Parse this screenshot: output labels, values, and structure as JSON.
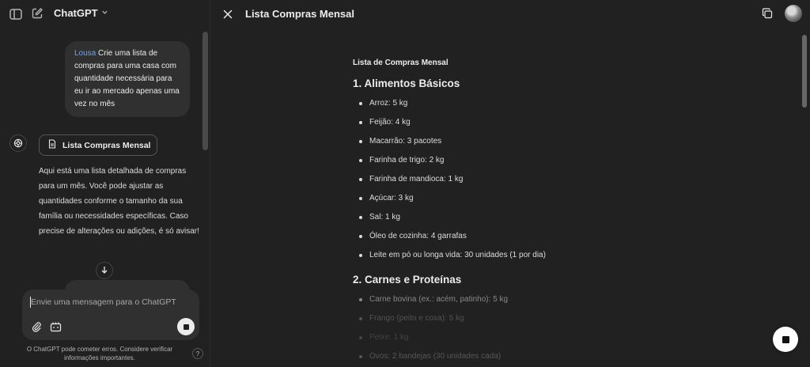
{
  "header": {
    "model_name": "ChatGPT"
  },
  "chat": {
    "user_message": {
      "tag": "Lousa",
      "text": "Crie uma lista de compras para uma casa com quantidade necessária para eu ir ao mercado apenas uma vez no mês"
    },
    "canvas_chip_label": "Lista Compras Mensal",
    "assistant_message": "Aqui está uma lista detalhada de compras para um mês. Você pode ajustar as quantidades conforme o tamanho da sua família ou necessidades específicas. Caso precise de alterações ou adições, é só avisar!"
  },
  "composer": {
    "placeholder": "Envie uma mensagem para o ChatGPT",
    "disclaimer": "O ChatGPT pode cometer erros. Considere verificar informações importantes.",
    "help_label": "?"
  },
  "canvas": {
    "title": "Lista Compras Mensal",
    "document_heading": "Lista de Compras Mensal",
    "sections": [
      {
        "title": "1. Alimentos Básicos",
        "items": [
          "Arroz: 5 kg",
          "Feijão: 4 kg",
          "Macarrão: 3 pacotes",
          "Farinha de trigo: 2 kg",
          "Farinha de mandioca: 1 kg",
          "Açúcar: 3 kg",
          "Sal: 1 kg",
          "Óleo de cozinha: 4 garrafas",
          "Leite em pó ou longa vida: 30 unidades (1 por dia)"
        ]
      },
      {
        "title": "2. Carnes e Proteínas",
        "items": [
          "Carne bovina (ex.: acém, patinho): 5 kg",
          "Frango (peito e coxa): 5 kg",
          "Peixe: 1 kg",
          "Ovos: 2 bandejas (30 unidades cada)"
        ]
      }
    ]
  },
  "icons": {
    "sidebar_toggle": "sidebar-icon",
    "new_chat": "pencil-square-icon",
    "close": "close-icon",
    "copy": "copy-icon",
    "attach": "paperclip-icon",
    "tools": "tools-icon",
    "stop": "stop-icon",
    "scroll_down": "arrow-down-icon"
  }
}
